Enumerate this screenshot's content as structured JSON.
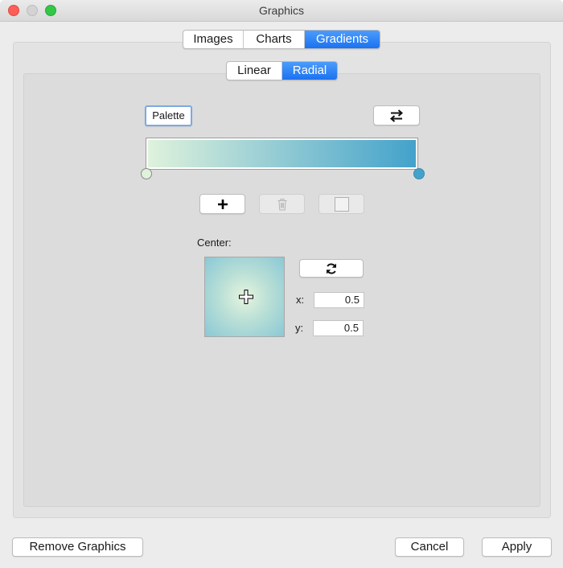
{
  "window": {
    "title": "Graphics"
  },
  "tabs": {
    "main": [
      {
        "label": "Images",
        "selected": false
      },
      {
        "label": "Charts",
        "selected": false
      },
      {
        "label": "Gradients",
        "selected": true
      }
    ],
    "sub": [
      {
        "label": "Linear",
        "selected": false
      },
      {
        "label": "Radial",
        "selected": true
      }
    ]
  },
  "gradient": {
    "palette_label": "Palette",
    "swap_icon": "swap-arrows-icon",
    "start_color": "#dff2dc",
    "end_color": "#43a2cb",
    "stop_buttons": {
      "add_icon": "plus-icon",
      "delete_icon": "trash-icon",
      "color_icon": "color-swatch-icon"
    }
  },
  "center": {
    "label": "Center:",
    "reset_icon": "refresh-icon",
    "x_label": "x:",
    "x_value": "0.5",
    "y_label": "y:",
    "y_value": "0.5"
  },
  "footer": {
    "remove_label": "Remove Graphics",
    "cancel_label": "Cancel",
    "apply_label": "Apply"
  },
  "colors": {
    "accent": "#1c72f0"
  }
}
